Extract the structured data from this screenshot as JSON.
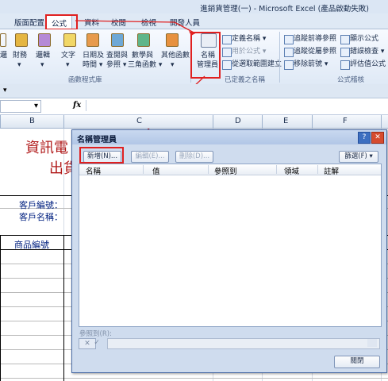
{
  "window": {
    "title": "進銷貨管理(一) - Microsoft Excel (產品啟動失敗)"
  },
  "tabs": [
    {
      "label": "版面配置",
      "active": false
    },
    {
      "label": "公式",
      "active": true
    },
    {
      "label": "資料",
      "active": false
    },
    {
      "label": "校閱",
      "active": false
    },
    {
      "label": "檢視",
      "active": false
    },
    {
      "label": "開發人員",
      "active": false
    }
  ],
  "ribbon": {
    "function_library": {
      "buttons": [
        {
          "line1": "邏",
          "line2": "▾",
          "icon_color": "#5f8fd0"
        },
        {
          "line1": "財務",
          "line2": "▾",
          "icon_color": "#d4a32c"
        },
        {
          "line1": "邏輯",
          "line2": "▾",
          "icon_color": "#a06ac4"
        },
        {
          "line1": "文字",
          "line2": "▾",
          "icon_color": "#e3c24b"
        },
        {
          "line1": "日期及",
          "line2": "時間 ▾",
          "icon_color": "#d8832c"
        },
        {
          "line1": "查閱與",
          "line2": "參照 ▾",
          "icon_color": "#4d8fbf"
        },
        {
          "line1": "數學與",
          "line2": "三角函數 ▾",
          "icon_color": "#3f9a6f"
        },
        {
          "line1": "其他函數",
          "line2": "▾",
          "icon_color": "#d98432"
        }
      ],
      "group_label": "函數程式庫"
    },
    "defined_names": {
      "name_manager": {
        "line1": "名稱",
        "line2": "管理員"
      },
      "items": [
        "定義名稱 ▾",
        "用於公式 ▾",
        "從選取範圍建立"
      ],
      "group_label": "已定義之名稱"
    },
    "formula_auditing": {
      "items": [
        "追蹤前導參照",
        "追蹤從屬參照",
        "移除箭號 ▾",
        "顯示公式",
        "錯誤檢查 ▾",
        "評估值公式"
      ],
      "group_label": "公式稽核"
    }
  },
  "formula_bar": {
    "fx": "fx",
    "dropdown": "▾"
  },
  "columns": [
    "B",
    "C",
    "D",
    "E",
    "F"
  ],
  "sheet": {
    "title_line1": "資訊電",
    "title_line2": "出貨",
    "customer_id_label": "客戶編號：",
    "customer_name_label": "客戶名稱：",
    "product_id_header": "商品編號"
  },
  "dialog": {
    "title": "名稱管理員",
    "help": "?",
    "close": "✕",
    "new_button": "新增(N)...",
    "edit_button": "編輯(E)...",
    "delete_button": "刪除(D)...",
    "filter_button": "篩選(F) ▾",
    "columns": [
      "名稱",
      "值",
      "參照到",
      "領域",
      "註解"
    ],
    "refers_to_label": "參照到(R):",
    "close_button": "關閉"
  }
}
